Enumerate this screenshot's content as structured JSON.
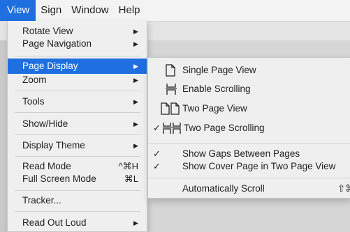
{
  "menubar": {
    "items": [
      "View",
      "Sign",
      "Window",
      "Help"
    ]
  },
  "view_menu": {
    "rotate_view": "Rotate View",
    "page_navigation": "Page Navigation",
    "page_display": "Page Display",
    "zoom": "Zoom",
    "tools": "Tools",
    "show_hide": "Show/Hide",
    "display_theme": "Display Theme",
    "read_mode": "Read Mode",
    "read_mode_shortcut": "^⌘H",
    "full_screen_mode": "Full Screen Mode",
    "full_screen_shortcut": "⌘L",
    "tracker": "Tracker...",
    "read_out_loud": "Read Out Loud"
  },
  "page_display_submenu": {
    "single_page_view": "Single Page View",
    "enable_scrolling": "Enable Scrolling",
    "two_page_view": "Two Page View",
    "two_page_scrolling": "Two Page Scrolling",
    "show_gaps": "Show Gaps Between Pages",
    "show_cover_page": "Show Cover Page in Two Page View",
    "automatically_scroll": "Automatically Scroll",
    "automatically_scroll_shortcut": "⇧⌘",
    "check_glyph": "✓"
  },
  "colors": {
    "highlight": "#1f6fe0",
    "menu_bg": "#efefef"
  }
}
